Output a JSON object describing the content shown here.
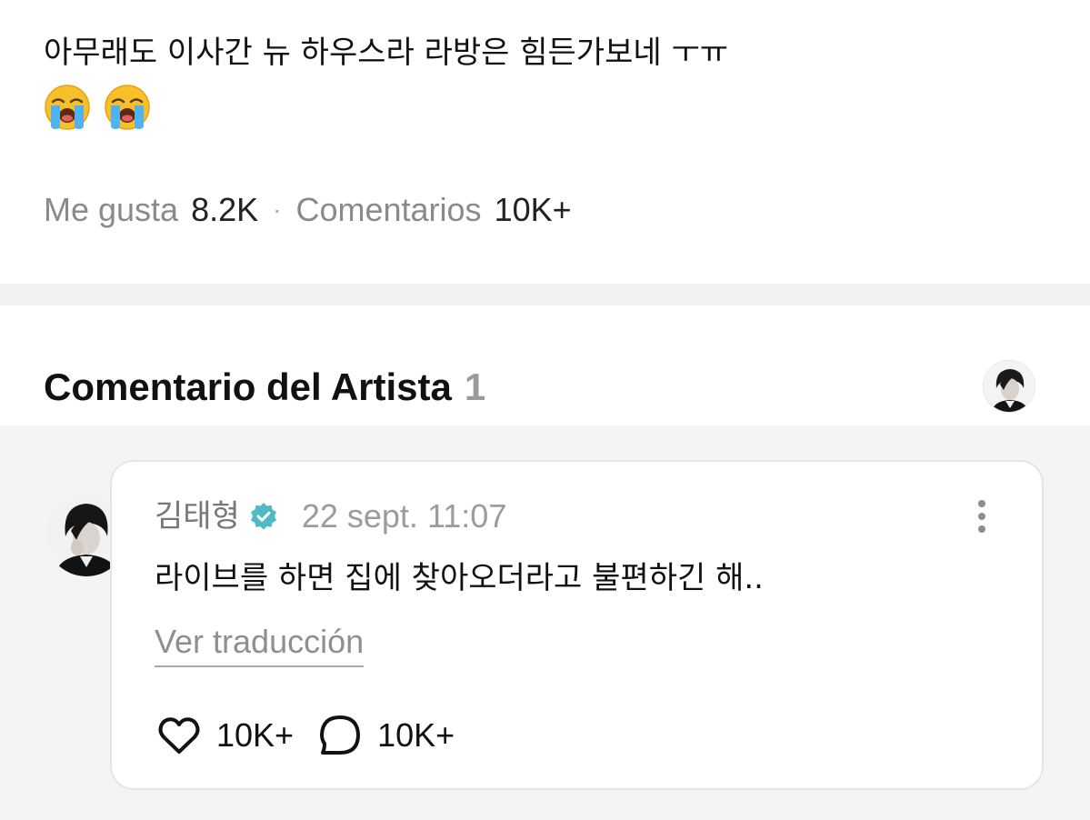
{
  "post": {
    "text": "아무래도 이사간 뉴 하우스라 라방은 힘든가보네 ㅜㅠ",
    "emojis": [
      "loudly-crying-face",
      "loudly-crying-face"
    ],
    "likes_label": "Me gusta",
    "likes_count": "8.2K",
    "separator": "·",
    "comments_label": "Comentarios",
    "comments_count": "10K+"
  },
  "artist_comments": {
    "title": "Comentario del Artista",
    "count": "1"
  },
  "comment": {
    "author": "김태형",
    "verified": true,
    "timestamp": "22 sept. 11:07",
    "body": "라이브를 하면 집에 찾아오더라고 불편하긴 해..",
    "translate_label": "Ver traducción",
    "like_count": "10K+",
    "reply_count": "10K+"
  },
  "colors": {
    "verified_badge": "#4fb9c8",
    "divider_band": "#f2f2f3",
    "comment_area_bg": "#f3f4f6",
    "muted_text": "#8a8a8a"
  }
}
